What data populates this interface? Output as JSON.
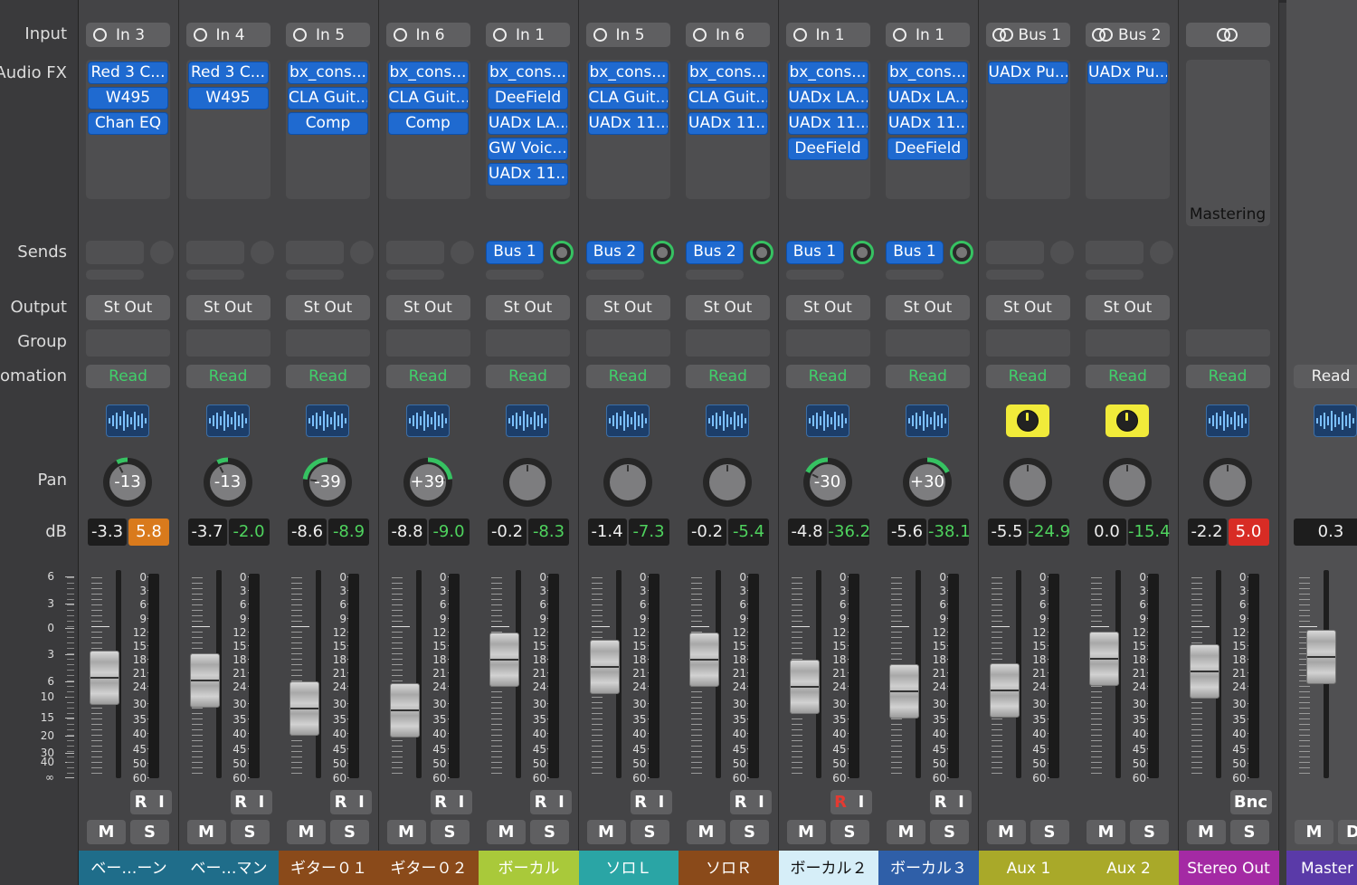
{
  "row_labels": {
    "input": "Input",
    "audio_fx": "Audio FX",
    "sends": "Sends",
    "output": "Output",
    "group": "Group",
    "automation": "omation",
    "pan": "Pan",
    "db": "dB"
  },
  "master_scale_labels": [
    "6",
    "3",
    "0",
    "3",
    "6",
    "10",
    "15",
    "20",
    "30",
    "40",
    "∞"
  ],
  "meter_scale_labels": [
    "0",
    "3",
    "6",
    "9",
    "12",
    "15",
    "18",
    "21",
    "24",
    "30",
    "35",
    "40",
    "45",
    "50",
    "60"
  ],
  "strips": [
    {
      "input": "In 3",
      "input_icon": "ring",
      "fx": [
        "Red 3 C...",
        "W495",
        "Chan EQ"
      ],
      "send": "",
      "output": "St Out",
      "automation": "Read",
      "icon": "waveform-icon",
      "pan": "-13",
      "pan_value": -13,
      "db_left": "-3.3",
      "db_right": "5.8",
      "db_right_style": "orange",
      "fader_db": -3.3,
      "ri": [
        "R",
        "I"
      ],
      "mute": "M",
      "solo": "S",
      "name": "ベー…ーン",
      "color": "#1f6d8a"
    },
    {
      "input": "In 4",
      "input_icon": "ring",
      "fx": [
        "Red 3 C...",
        "W495"
      ],
      "send": "",
      "output": "St Out",
      "automation": "Read",
      "icon": "waveform-icon",
      "pan": "-13",
      "pan_value": -13,
      "db_left": "-3.7",
      "db_right": "-2.0",
      "db_right_style": "green",
      "fader_db": -3.7,
      "ri": [
        "R",
        "I"
      ],
      "mute": "M",
      "solo": "S",
      "name": "ベー…マン",
      "color": "#1f6d8a"
    },
    {
      "input": "In 5",
      "input_icon": "ring",
      "fx": [
        "bx_cons...",
        "CLA Guit...",
        "Comp"
      ],
      "send": "",
      "output": "St Out",
      "automation": "Read",
      "icon": "waveform-icon",
      "pan": "-39",
      "pan_value": -39,
      "db_left": "-8.6",
      "db_right": "-8.9",
      "db_right_style": "green",
      "fader_db": -8.6,
      "ri": [
        "R",
        "I"
      ],
      "mute": "M",
      "solo": "S",
      "name": "ギター０１",
      "color": "#8a4a1a"
    },
    {
      "input": "In 6",
      "input_icon": "ring",
      "fx": [
        "bx_cons...",
        "CLA Guit...",
        "Comp"
      ],
      "send": "",
      "output": "St Out",
      "automation": "Read",
      "icon": "waveform-icon",
      "pan": "+39",
      "pan_value": 39,
      "db_left": "-8.8",
      "db_right": "-9.0",
      "db_right_style": "green",
      "fader_db": -8.8,
      "ri": [
        "R",
        "I"
      ],
      "mute": "M",
      "solo": "S",
      "name": "ギター０２",
      "color": "#8a4a1a"
    },
    {
      "input": "In 1",
      "input_icon": "ring",
      "fx": [
        "bx_cons...",
        "DeeField",
        "UADx LA...",
        "GW Voic...",
        "UADx 11..."
      ],
      "send": "Bus 1",
      "output": "St Out",
      "automation": "Read",
      "icon": "waveform-icon",
      "pan": "",
      "pan_value": 0,
      "db_left": "-0.2",
      "db_right": "-8.3",
      "db_right_style": "green",
      "fader_db": -0.2,
      "ri": [
        "R",
        "I"
      ],
      "mute": "M",
      "solo": "S",
      "name": "ボーカル",
      "color": "#a9c93a"
    },
    {
      "input": "In 5",
      "input_icon": "ring",
      "fx": [
        "bx_cons...",
        "CLA Guit...",
        "UADx 11..."
      ],
      "send": "Bus 2",
      "output": "St Out",
      "automation": "Read",
      "icon": "waveform-icon",
      "pan": "",
      "pan_value": 0,
      "db_left": "-1.4",
      "db_right": "-7.3",
      "db_right_style": "green",
      "fader_db": -1.4,
      "ri": [
        "R",
        "I"
      ],
      "mute": "M",
      "solo": "S",
      "name": "ソロＬ",
      "color": "#2aa5a5"
    },
    {
      "input": "In 6",
      "input_icon": "ring",
      "fx": [
        "bx_cons...",
        "CLA Guit...",
        "UADx 11..."
      ],
      "send": "Bus 2",
      "output": "St Out",
      "automation": "Read",
      "icon": "waveform-icon",
      "pan": "",
      "pan_value": 0,
      "db_left": "-0.2",
      "db_right": "-5.4",
      "db_right_style": "green",
      "fader_db": -0.2,
      "ri": [
        "R",
        "I"
      ],
      "mute": "M",
      "solo": "S",
      "name": "ソロＲ",
      "color": "#8a4a1a"
    },
    {
      "input": "In 1",
      "input_icon": "ring",
      "fx": [
        "bx_cons...",
        "UADx LA...",
        "UADx 11...",
        "DeeField"
      ],
      "send": "Bus 1",
      "output": "St Out",
      "automation": "Read",
      "icon": "waveform-icon",
      "pan": "-30",
      "pan_value": -30,
      "db_left": "-4.8",
      "db_right": "-36.2",
      "db_right_style": "green",
      "fader_db": -4.8,
      "ri": [
        "R",
        "I"
      ],
      "ri_red": true,
      "mute": "M",
      "solo": "S",
      "name": "ボーカル２",
      "color": "#d6eef8"
    },
    {
      "input": "In 1",
      "input_icon": "ring",
      "fx": [
        "bx_cons...",
        "UADx LA...",
        "UADx 11...",
        "DeeField"
      ],
      "send": "Bus 1",
      "output": "St Out",
      "automation": "Read",
      "icon": "waveform-icon",
      "pan": "+30",
      "pan_value": 30,
      "db_left": "-5.6",
      "db_right": "-38.1",
      "db_right_style": "green",
      "fader_db": -5.6,
      "ri": [
        "R",
        "I"
      ],
      "mute": "M",
      "solo": "S",
      "name": "ボーカル３",
      "color": "#2f5fa8"
    },
    {
      "input": "Bus 1",
      "input_icon": "link",
      "fx": [
        "UADx Pu..."
      ],
      "send": "",
      "output": "St Out",
      "automation": "Read",
      "icon": "knob-icon",
      "pan": "",
      "pan_value": 0,
      "db_left": "-5.5",
      "db_right": "-24.9",
      "db_right_style": "green",
      "fader_db": -5.5,
      "ri": [],
      "mute": "M",
      "solo": "S",
      "name": "Aux 1",
      "color": "#a9a929"
    },
    {
      "input": "Bus 2",
      "input_icon": "link",
      "fx": [
        "UADx Pu..."
      ],
      "send": "",
      "output": "St Out",
      "automation": "Read",
      "icon": "knob-icon",
      "pan": "",
      "pan_value": 0,
      "db_left": "0.0",
      "db_right": "-15.4",
      "db_right_style": "green",
      "fader_db": 0.0,
      "ri": [],
      "mute": "M",
      "solo": "S",
      "name": "Aux 2",
      "color": "#a9a929"
    },
    {
      "input": "",
      "input_icon": "link",
      "fx": [],
      "mastering": "Mastering",
      "send": "",
      "output": "",
      "automation": "Read",
      "icon": "waveform-icon",
      "pan": "",
      "pan_value": 0,
      "db_left": "-2.2",
      "db_right": "5.0",
      "db_right_style": "red",
      "fader_db": -2.2,
      "bnc": "Bnc",
      "ri": [],
      "mute": "M",
      "solo": "S",
      "name": "Stereo Out",
      "color": "#a42aa4"
    }
  ],
  "master": {
    "automation": "Read",
    "icon": "waveform-icon",
    "db": "0.3",
    "fader_db": 0.3,
    "mute": "M",
    "solo_partial": "D",
    "name": "Master",
    "color": "#5a3aa8"
  }
}
